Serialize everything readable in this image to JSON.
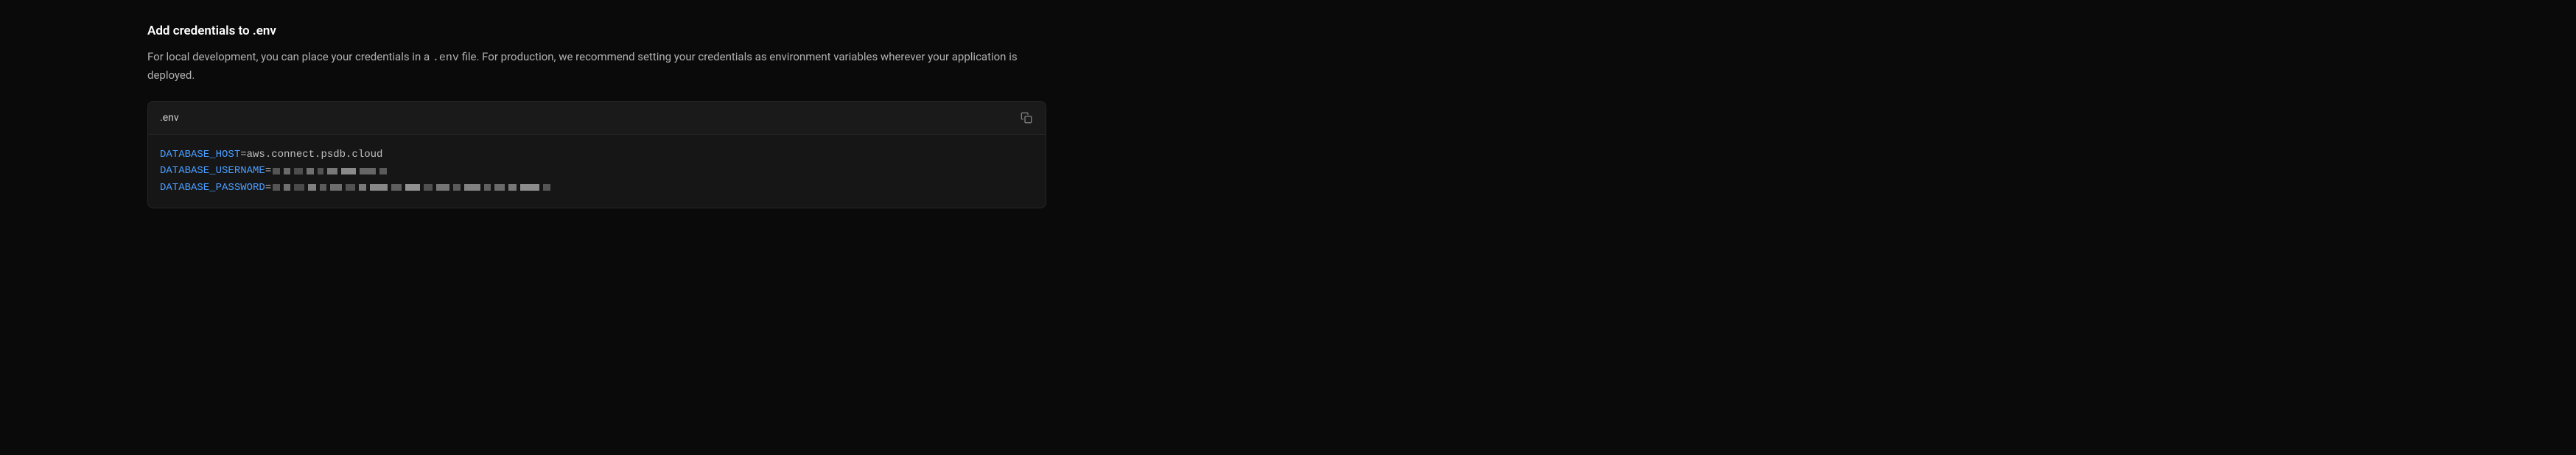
{
  "section": {
    "title": "Add credentials to .env",
    "description_part1": "For local development, you can place your credentials in a ",
    "description_code": ".env",
    "description_part2": " file. For production, we recommend setting your credentials as environment variables wherever your application is deployed."
  },
  "codeblock": {
    "filename": ".env",
    "lines": [
      {
        "key": "DATABASE_HOST",
        "value": "aws.connect.psdb.cloud",
        "masked": false
      },
      {
        "key": "DATABASE_USERNAME",
        "value": "",
        "masked": true,
        "maskLength": "short"
      },
      {
        "key": "DATABASE_PASSWORD",
        "value": "",
        "masked": true,
        "maskLength": "long"
      }
    ]
  }
}
